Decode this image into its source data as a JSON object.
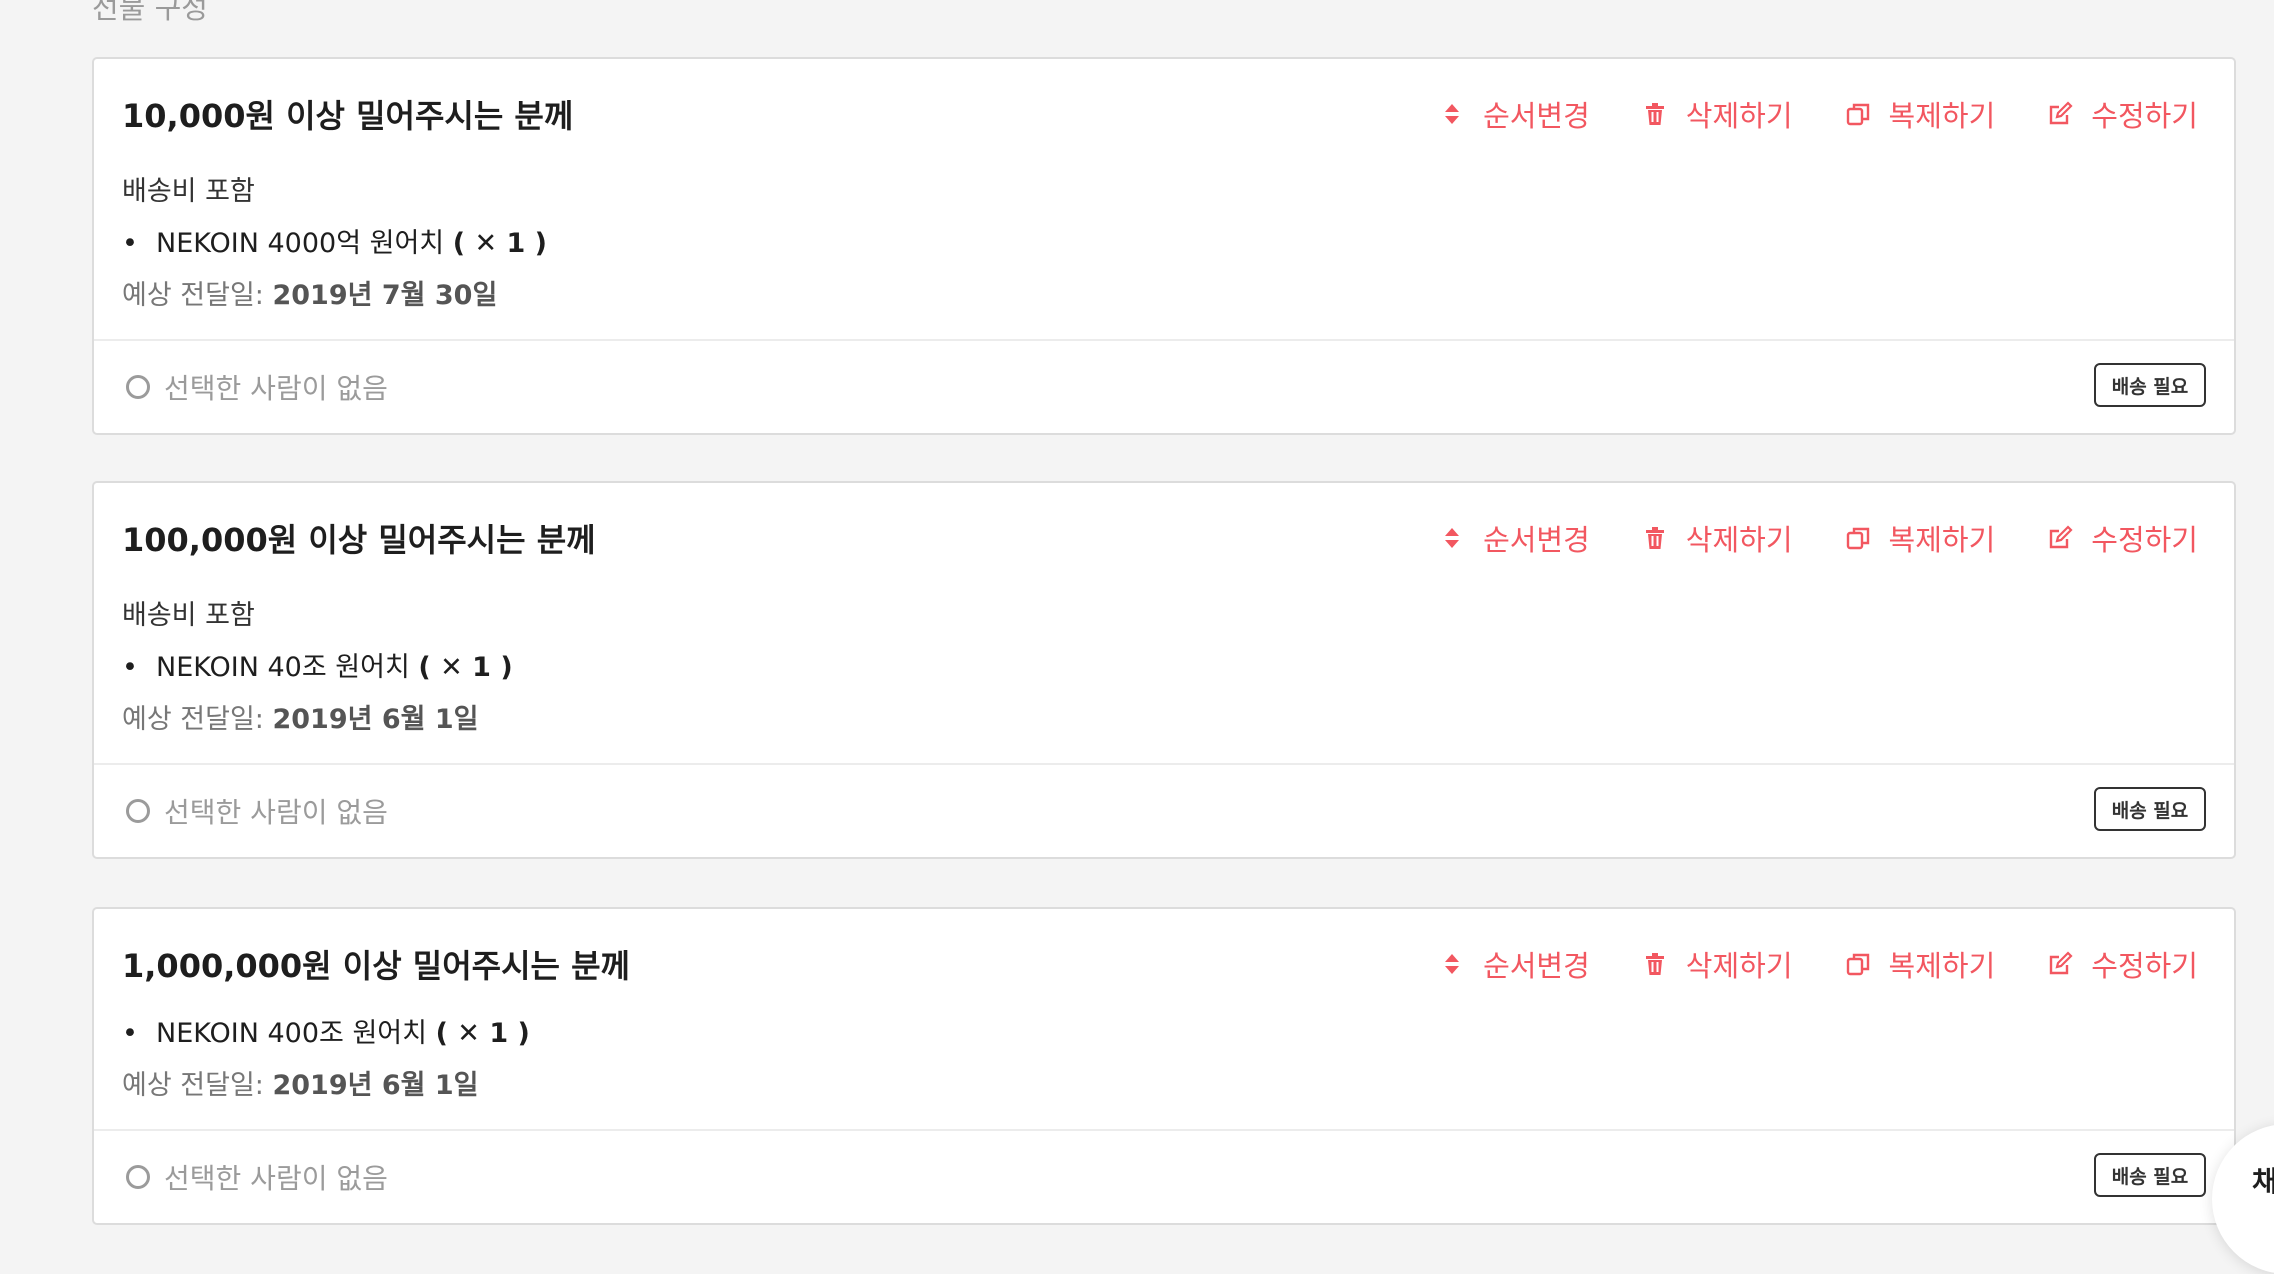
{
  "section": {
    "title": "선물 구성"
  },
  "actions": {
    "reorder": "순서변경",
    "delete": "삭제하기",
    "duplicate": "복제하기",
    "edit": "수정하기"
  },
  "accent_color": "#f25760",
  "rewards": [
    {
      "title": "10,000원 이상 밀어주시는 분께",
      "shipping_note": "배송비 포함",
      "item": "NEKOIN 4000억 원어치",
      "qty": "( ✕ 1 )",
      "delivery_label": "예상 전달일:",
      "delivery_date": "2019년 7월 30일",
      "backers": "선택한 사람이 없음",
      "tag": "배송 필요"
    },
    {
      "title": "100,000원 이상 밀어주시는 분께",
      "shipping_note": "배송비 포함",
      "item": "NEKOIN 40조 원어치",
      "qty": "( ✕ 1 )",
      "delivery_label": "예상 전달일:",
      "delivery_date": "2019년 6월 1일",
      "backers": "선택한 사람이 없음",
      "tag": "배송 필요"
    },
    {
      "title": "1,000,000원 이상 밀어주시는 분께",
      "item": "NEKOIN 400조 원어치",
      "qty": "( ✕ 1 )",
      "delivery_label": "예상 전달일:",
      "delivery_date": "2019년 6월 1일",
      "backers": "선택한 사람이 없음",
      "tag": "배송 필요"
    }
  ],
  "floating_button": {
    "label": "채"
  }
}
